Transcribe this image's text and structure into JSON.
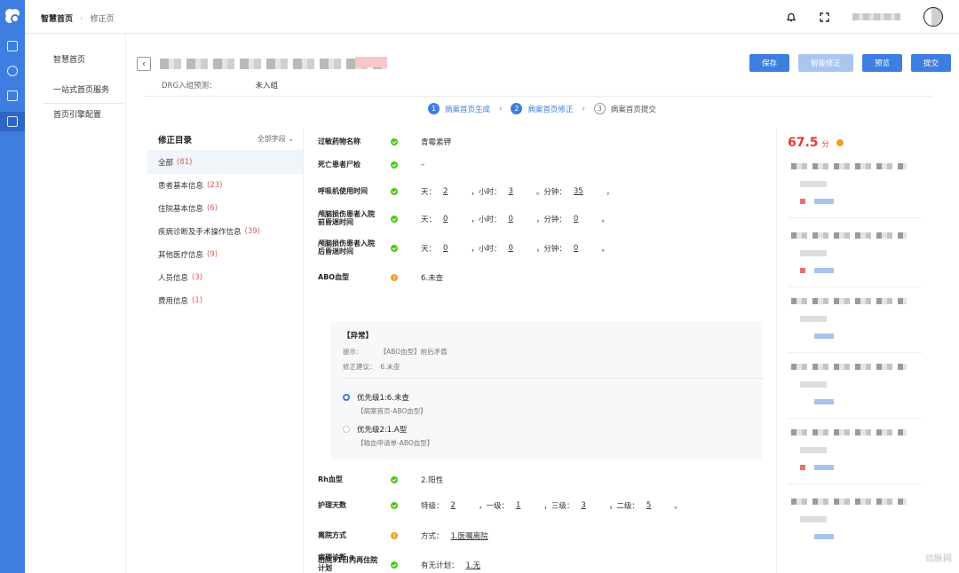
{
  "breadcrumb": {
    "home": "智慧首页",
    "current": "修正页"
  },
  "subnav": {
    "items": [
      "智慧首页",
      "一站式首页服务",
      "首页引擎配置"
    ]
  },
  "drg": {
    "label": "DRG入组预测：",
    "value": "未入组"
  },
  "buttons": {
    "save": "保存",
    "smart_fix": "智能修正",
    "preview": "预览",
    "submit": "提交"
  },
  "steps": [
    {
      "num": "1",
      "label": "病案首页生成"
    },
    {
      "num": "2",
      "label": "病案首页修正"
    },
    {
      "num": "3",
      "label": "病案首页提交"
    }
  ],
  "catalog": {
    "title": "修正目录",
    "filter": "全部字段",
    "items": [
      {
        "label": "全部",
        "count": "(81)"
      },
      {
        "label": "患者基本信息",
        "count": "(23)"
      },
      {
        "label": "住院基本信息",
        "count": "(6)"
      },
      {
        "label": "疾病诊断及手术操作信息",
        "count": "(39)"
      },
      {
        "label": "其他医疗信息",
        "count": "(9)"
      },
      {
        "label": "人员信息",
        "count": "(3)"
      },
      {
        "label": "费用信息",
        "count": "(1)"
      }
    ]
  },
  "form": {
    "allergy": {
      "label": "过敏药物名称",
      "value": "青霉素钾"
    },
    "autopsy": {
      "label": "死亡患者尸检",
      "value": "–"
    },
    "ventilator": {
      "label": "呼吸机使用时间",
      "day_label": "天：",
      "day": "2",
      "hour_label": "，小时：",
      "hour": "3",
      "min_label": "。分钟：",
      "min": "35",
      "end": "，"
    },
    "coma_before": {
      "label1": "颅脑损伤患者入院",
      "label2": "前昏迷时间",
      "day_label": "天：",
      "day": "0",
      "hour_label": "，小时：",
      "hour": "0",
      "min_label": "，分钟：",
      "min": "0",
      "end": "。"
    },
    "coma_after": {
      "label1": "颅脑损伤患者入院",
      "label2": "后昏迷时间",
      "day_label": "天：",
      "day": "0",
      "hour_label": "，小时：",
      "hour": "0",
      "min_label": "，分钟：",
      "min": "0",
      "end": "。"
    },
    "abo": {
      "label": "ABO血型",
      "value": "6.未查"
    },
    "abnormal": {
      "title": "【异常】",
      "tip_label": "提示：",
      "tip": "【ABO血型】前后矛盾",
      "suggest_label": "修正建议：",
      "suggest": "6.未查",
      "options": [
        {
          "label": "优先级1:6.未查",
          "source": "【病案首页-ABO血型】"
        },
        {
          "label": "优先级2:1.A型",
          "source": "【输血申请单-ABO血型】"
        }
      ]
    },
    "rh": {
      "label": "Rh血型",
      "value": "2.阳性"
    },
    "nursing": {
      "label": "护理天数",
      "special_label": "特级：",
      "special": "2",
      "first_label": "，一级：",
      "first": "1",
      "third_label": "，三级：",
      "third": "3",
      "second_label": "，二级：",
      "second": "5",
      "end": "。"
    },
    "discharge": {
      "label": "离院方式",
      "method_label": "方式：",
      "method": "1.医嘱离院"
    },
    "readmit": {
      "label1": "出院31日内再住院",
      "label2": "计划",
      "plan_label": "有无计划：",
      "plan": "1.无"
    },
    "pathology": {
      "label": "病理诊断 ⊕"
    }
  },
  "score": {
    "value": "67.5",
    "unit": "分"
  },
  "watermark": "动脉网"
}
